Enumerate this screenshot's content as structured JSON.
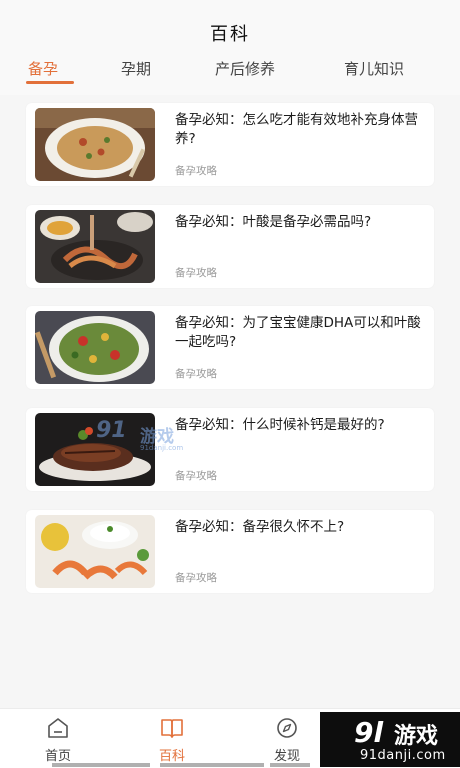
{
  "header": {
    "title": "百科"
  },
  "tabs": [
    {
      "label": "备孕",
      "active": true
    },
    {
      "label": "孕期",
      "active": false
    },
    {
      "label": "产后修养",
      "active": false
    },
    {
      "label": "育儿知识",
      "active": false
    }
  ],
  "articles": [
    {
      "title": "备孕必知：怎么吃才能有效地补充身体营养?",
      "tag": "备孕攻略",
      "image": "pasta-plate"
    },
    {
      "title": "备孕必知：叶酸是备孕必需品吗?",
      "tag": "备孕攻略",
      "image": "noodle-dish"
    },
    {
      "title": "备孕必知：为了宝宝健康DHA可以和叶酸一起吃吗?",
      "tag": "备孕攻略",
      "image": "vegetable-stirfry"
    },
    {
      "title": "备孕必知：什么时候补钙是最好的?",
      "tag": "备孕攻略",
      "image": "grilled-meat"
    },
    {
      "title": "备孕必知：备孕很久怀不上?",
      "tag": "备孕攻略",
      "image": "shrimp-rice"
    }
  ],
  "watermark": {
    "number": "91",
    "text": "游戏",
    "url": "91danji.com"
  },
  "bottom_nav": [
    {
      "label": "首页",
      "icon": "home-icon",
      "active": false
    },
    {
      "label": "百科",
      "icon": "book-icon",
      "active": true
    },
    {
      "label": "发现",
      "icon": "compass-icon",
      "active": false
    }
  ],
  "brand_badge": {
    "number": "9l",
    "text": "游戏",
    "url": "91danji.com"
  },
  "colors": {
    "accent": "#e2703a",
    "background": "#f6f6f6",
    "card": "#ffffff",
    "muted_text": "#9a9a9a"
  }
}
